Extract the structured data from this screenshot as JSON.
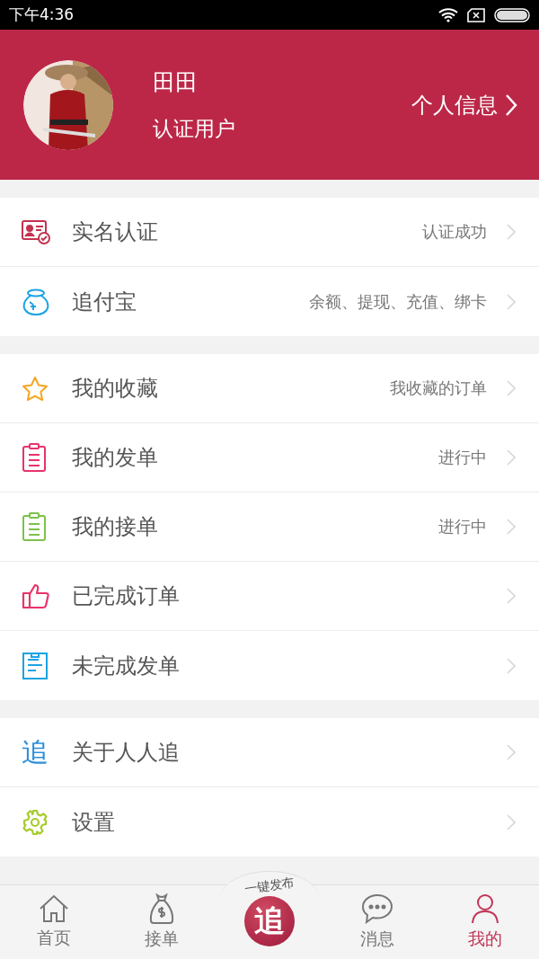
{
  "status_bar": {
    "time": "下午4:36"
  },
  "profile": {
    "name": "田田",
    "subtitle": "认证用户",
    "link": "个人信息"
  },
  "sections": [
    {
      "items": [
        {
          "label": "实名认证",
          "detail": "认证成功"
        },
        {
          "label": "追付宝",
          "detail": "余额、提现、充值、绑卡"
        }
      ]
    },
    {
      "items": [
        {
          "label": "我的收藏",
          "detail": "我收藏的订单"
        },
        {
          "label": "我的发单",
          "detail": "进行中"
        },
        {
          "label": "我的接单",
          "detail": "进行中"
        },
        {
          "label": "已完成订单"
        },
        {
          "label": "未完成发单"
        }
      ]
    },
    {
      "items": [
        {
          "label": "关于人人追",
          "icon_text": "追"
        },
        {
          "label": "设置"
        }
      ]
    }
  ],
  "publish": {
    "caption": "一键发布",
    "logo": "追"
  },
  "tabs": [
    {
      "label": "首页",
      "selected": false
    },
    {
      "label": "接单",
      "selected": false
    },
    {
      "label": "消息",
      "selected": false
    },
    {
      "label": "我的",
      "selected": true
    }
  ]
}
